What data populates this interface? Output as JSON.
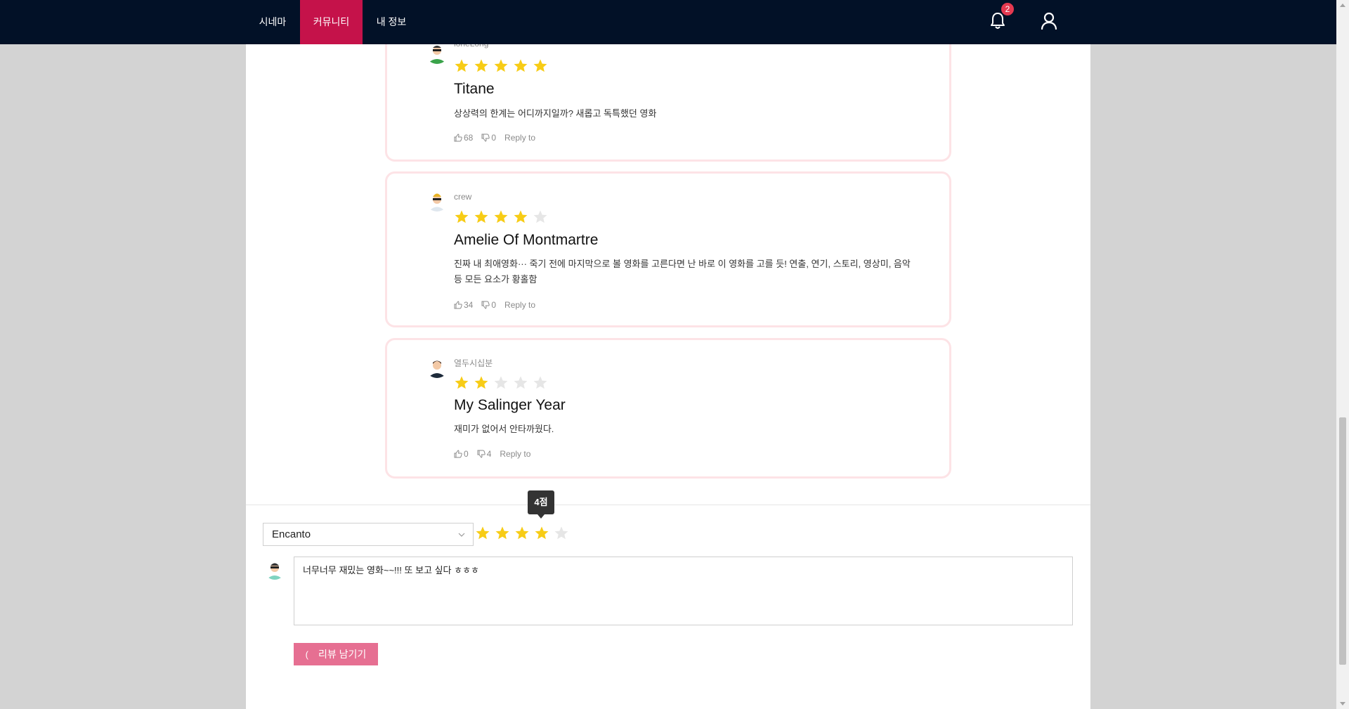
{
  "nav": {
    "items": [
      {
        "label": "시네마"
      },
      {
        "label": "커뮤니티"
      },
      {
        "label": "내 정보"
      }
    ],
    "notification_count": "2"
  },
  "reviews": [
    {
      "username": "loneLong",
      "rating": 5,
      "movie": "Titane",
      "text": "상상력의 한계는 어디까지일까? 새롭고 독특했던 영화",
      "likes": "68",
      "dislikes": "0",
      "reply_label": "Reply to"
    },
    {
      "username": "crew",
      "rating": 4,
      "movie": "Amelie Of Montmartre",
      "text": "진짜 내 최애영화··· 죽기 전에 마지막으로 볼 영화를 고른다면 난 바로 이 영화를 고를 듯! 연출, 연기, 스토리, 영상미, 음악 등 모든 요소가 황홀함",
      "likes": "34",
      "dislikes": "0",
      "reply_label": "Reply to"
    },
    {
      "username": "열두시십분",
      "rating": 2,
      "movie": "My Salinger Year",
      "text": "재미가 없어서 안타까웠다.",
      "likes": "0",
      "dislikes": "4",
      "reply_label": "Reply to"
    }
  ],
  "write": {
    "selected_movie": "Encanto",
    "rating": 4,
    "tooltip": "4점",
    "textarea_value": "너무너무 재밌는 영화~~!!! 또 보고 싶다 ㅎㅎㅎ",
    "submit_label": "리뷰 남기기"
  },
  "colors": {
    "nav_bg": "#021127",
    "nav_active": "#c5124a",
    "star_on": "#f7cc16",
    "star_off": "#e6e6e6",
    "card_border": "#fde3e6",
    "submit_bg": "#e66f92"
  }
}
